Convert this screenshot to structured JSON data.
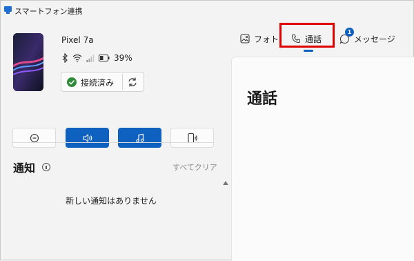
{
  "app": {
    "title": "スマートフォン連携"
  },
  "device": {
    "name": "Pixel 7a",
    "battery_percent": "39%",
    "connection_status": "接続済み"
  },
  "notifications": {
    "title": "通知",
    "clear_all": "すべてクリア",
    "empty_message": "新しい通知はありません"
  },
  "tabs": [
    {
      "label": "フォト",
      "icon": "photo-icon"
    },
    {
      "label": "通話",
      "icon": "phone-icon",
      "selected": true
    },
    {
      "label": "メッセージ",
      "icon": "message-icon",
      "badge": "1"
    }
  ],
  "content": {
    "title": "通話"
  },
  "colors": {
    "accent": "#0f61c0",
    "highlight": "#e00000",
    "connected": "#2e8b3a"
  }
}
